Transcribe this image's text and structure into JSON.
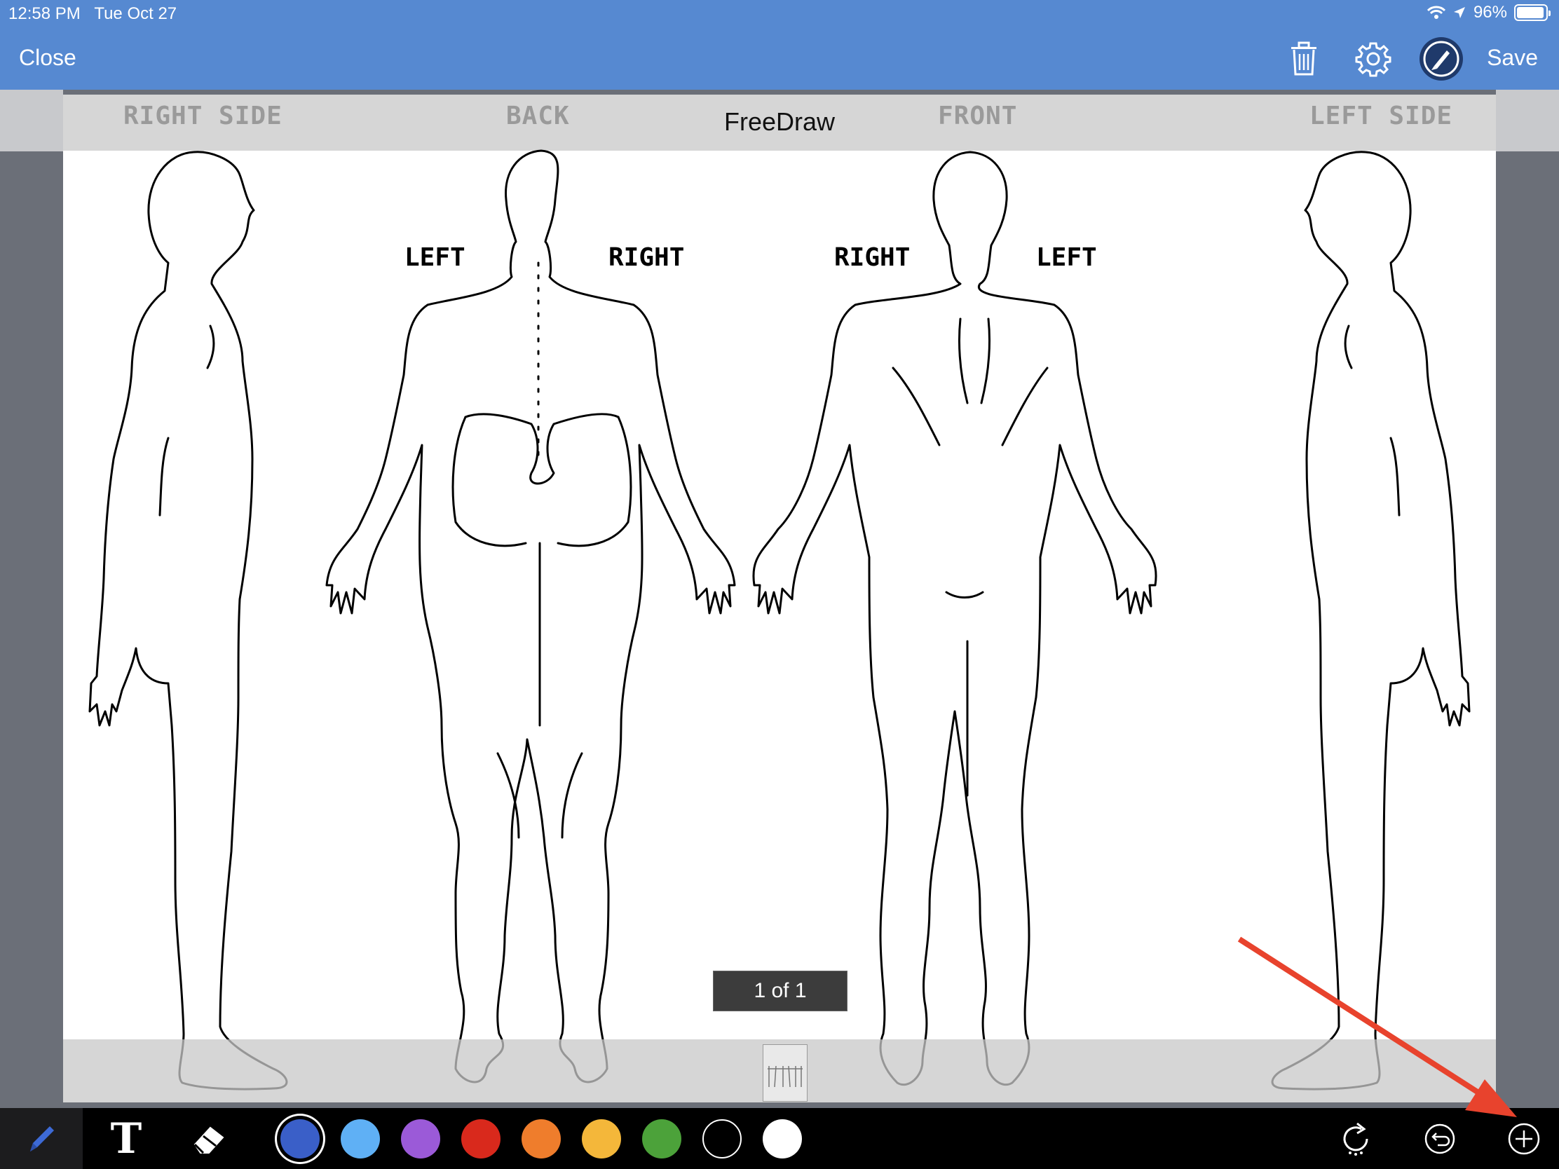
{
  "status_bar": {
    "time": "12:58 PM",
    "date": "Tue Oct 27",
    "battery": "96%",
    "battery_level": 0.96
  },
  "nav": {
    "close_label": "Close",
    "save_label": "Save",
    "icons": [
      "trash-icon",
      "gear-icon",
      "pen-circle-icon"
    ]
  },
  "document": {
    "title": "FreeDraw",
    "view_labels": {
      "right_side": "RIGHT SIDE",
      "back": "BACK",
      "front": "FRONT",
      "left_side": "LEFT SIDE"
    },
    "back_labels": {
      "left": "LEFT",
      "right": "RIGHT"
    },
    "front_labels": {
      "right": "RIGHT",
      "left": "LEFT"
    },
    "page_indicator": "1 of 1"
  },
  "toolbar": {
    "tools": [
      "pen-icon",
      "text-icon",
      "eraser-icon"
    ],
    "text_tool_glyph": "T",
    "colors": [
      {
        "name": "blue",
        "hex": "#3a5fc8",
        "selected": true
      },
      {
        "name": "light-blue",
        "hex": "#5fb0f5"
      },
      {
        "name": "purple",
        "hex": "#9b5ad8"
      },
      {
        "name": "red",
        "hex": "#d9291c"
      },
      {
        "name": "orange",
        "hex": "#ef7d2c"
      },
      {
        "name": "yellow",
        "hex": "#f4b73a"
      },
      {
        "name": "green",
        "hex": "#4ca23a"
      },
      {
        "name": "black",
        "hex": "#000000"
      },
      {
        "name": "white",
        "hex": "#ffffff"
      }
    ],
    "right_icons": [
      "redo-icon",
      "undo-icon",
      "add-page-icon"
    ]
  },
  "colors": {
    "nav_bar": "#5689d1",
    "annotation_arrow": "#e8432d"
  }
}
